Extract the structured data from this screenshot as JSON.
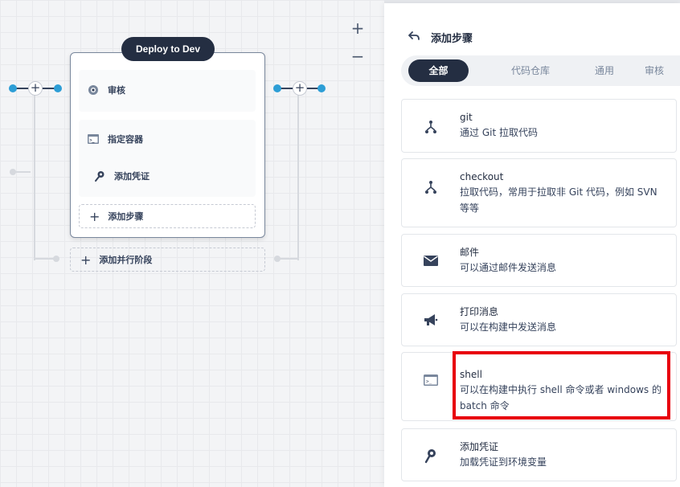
{
  "canvas": {
    "zoom_in": "+",
    "zoom_out": "−",
    "stage": {
      "title": "Deploy to Dev",
      "steps": [
        {
          "icon": "review-icon",
          "label": "审核"
        },
        {
          "icon": "container-icon",
          "label": "指定容器"
        },
        {
          "icon": "credential-key-icon",
          "label": "添加凭证"
        }
      ],
      "add_step_label": "添加步骤"
    },
    "add_parallel_stage_label": "添加并行阶段"
  },
  "panel": {
    "title": "添加步骤",
    "tabs": [
      "全部",
      "代码仓库",
      "通用",
      "审核"
    ],
    "active_tab": "全部",
    "cards": [
      {
        "icon": "git-branch-icon",
        "title": "git",
        "desc": "通过 Git 拉取代码"
      },
      {
        "icon": "git-branch-icon",
        "title": "checkout",
        "desc": "拉取代码，常用于拉取非 Git 代码，例如 SVN 等等"
      },
      {
        "icon": "mail-icon",
        "title": "邮件",
        "desc": "可以通过邮件发送消息"
      },
      {
        "icon": "megaphone-icon",
        "title": "打印消息",
        "desc": "可以在构建中发送消息"
      },
      {
        "icon": "terminal-icon",
        "title": "shell",
        "desc": "可以在构建中执行 shell 命令或者 windows 的 batch 命令"
      },
      {
        "icon": "key-icon",
        "title": "添加凭证",
        "desc": "加载凭证到环境变量"
      }
    ]
  },
  "colors": {
    "dark": "#242e42",
    "accent_blue": "#2d9ed6",
    "highlight_red": "#e8000c"
  }
}
